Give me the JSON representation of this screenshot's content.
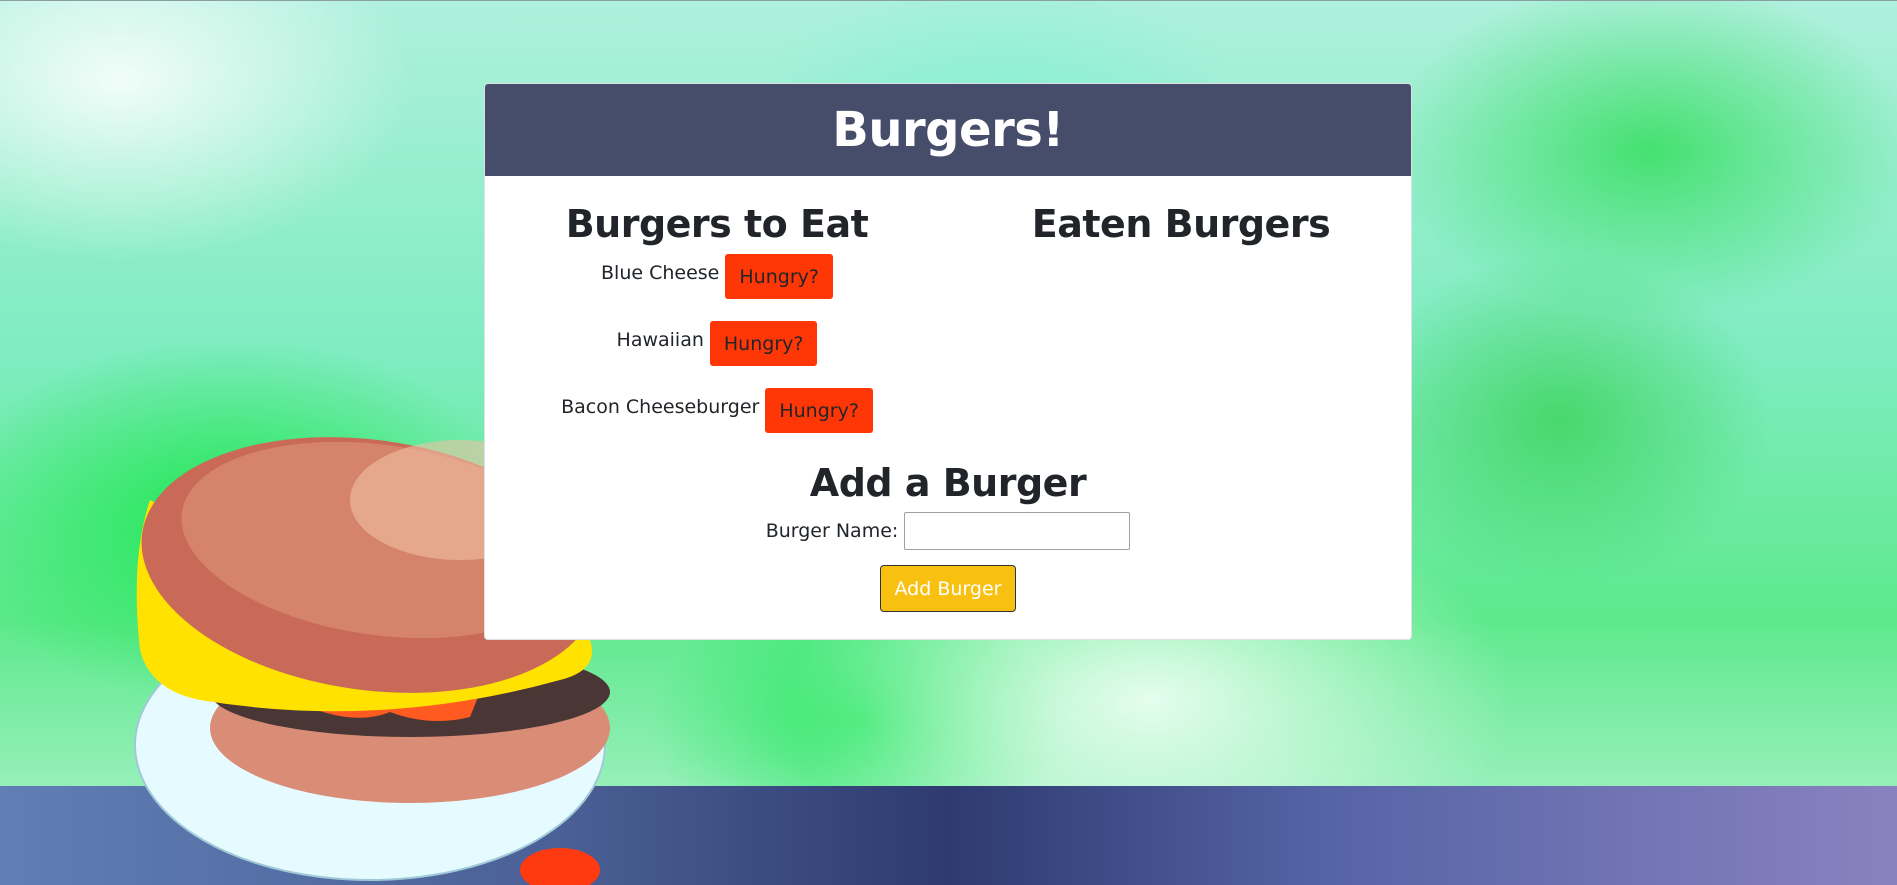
{
  "header": {
    "title": "Burgers!"
  },
  "to_eat": {
    "heading": "Burgers to Eat",
    "items": [
      {
        "name": "Blue Cheese",
        "button": "Hungry?"
      },
      {
        "name": "Hawaiian",
        "button": "Hungry?"
      },
      {
        "name": "Bacon Cheeseburger",
        "button": "Hungry?"
      }
    ]
  },
  "eaten": {
    "heading": "Eaten Burgers",
    "items": []
  },
  "add_form": {
    "heading": "Add a Burger",
    "label": "Burger Name:",
    "input_value": "",
    "input_placeholder": "",
    "submit_label": "Add Burger"
  },
  "colors": {
    "header_bg": "#454d6b",
    "hungry_button": "#ff3707",
    "add_button": "#f8c011"
  },
  "background": {
    "image": "watercolor-burger-illustration"
  }
}
